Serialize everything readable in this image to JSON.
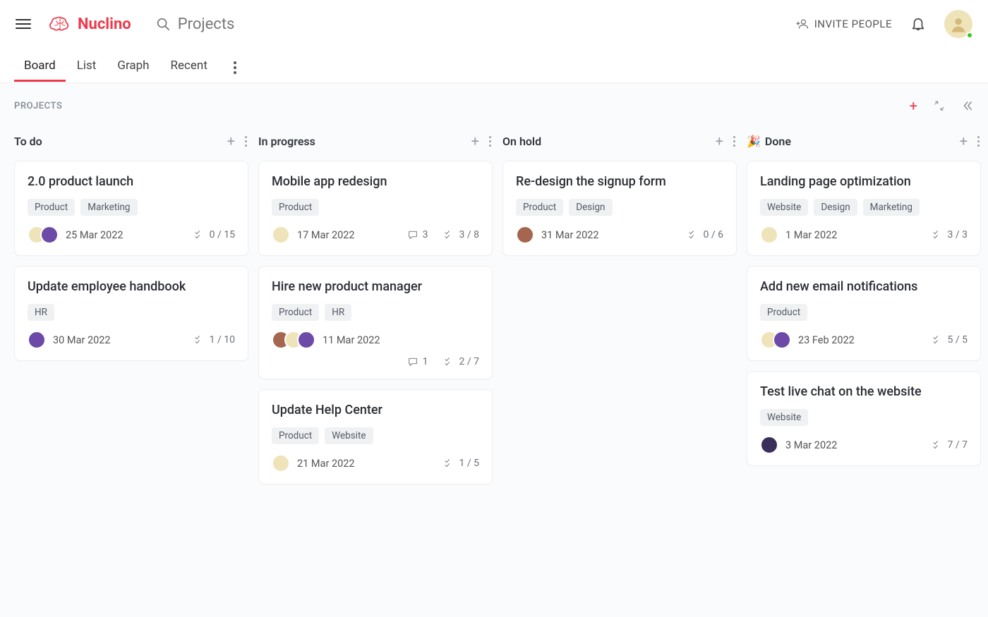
{
  "app": {
    "name": "Nuclino"
  },
  "header": {
    "search_placeholder": "Projects",
    "invite_label": "INVITE PEOPLE"
  },
  "tabs": [
    "Board",
    "List",
    "Graph",
    "Recent"
  ],
  "active_tab_index": 0,
  "board": {
    "breadcrumb": "PROJECTS",
    "columns": [
      {
        "title": "To do",
        "emoji": "",
        "cards": [
          {
            "title": "2.0 product launch",
            "tags": [
              "Product",
              "Marketing"
            ],
            "avatars": [
              "c1",
              "c2"
            ],
            "date": "25 Mar 2022",
            "comments": null,
            "checklist": "0 / 15"
          },
          {
            "title": "Update employee handbook",
            "tags": [
              "HR"
            ],
            "avatars": [
              "c2"
            ],
            "date": "30 Mar 2022",
            "comments": null,
            "checklist": "1 / 10"
          }
        ]
      },
      {
        "title": "In progress",
        "emoji": "",
        "cards": [
          {
            "title": "Mobile app redesign",
            "tags": [
              "Product"
            ],
            "avatars": [
              "c1"
            ],
            "date": "17 Mar 2022",
            "comments": "3",
            "checklist": "3 / 8"
          },
          {
            "title": "Hire new product manager",
            "tags": [
              "Product",
              "HR"
            ],
            "avatars": [
              "c3",
              "c1",
              "c2"
            ],
            "date": "11 Mar 2022",
            "comments": "1",
            "checklist": "2 / 7",
            "second_row": true
          },
          {
            "title": "Update Help Center",
            "tags": [
              "Product",
              "Website"
            ],
            "avatars": [
              "c1"
            ],
            "date": "21 Mar 2022",
            "comments": null,
            "checklist": "1 / 5"
          }
        ]
      },
      {
        "title": "On hold",
        "emoji": "",
        "cards": [
          {
            "title": "Re-design the signup form",
            "tags": [
              "Product",
              "Design"
            ],
            "avatars": [
              "c3"
            ],
            "date": "31 Mar 2022",
            "comments": null,
            "checklist": "0 / 6"
          }
        ]
      },
      {
        "title": "Done",
        "emoji": "🎉",
        "cards": [
          {
            "title": "Landing page optimization",
            "tags": [
              "Website",
              "Design",
              "Marketing"
            ],
            "avatars": [
              "c1"
            ],
            "date": "1 Mar 2022",
            "comments": null,
            "checklist": "3 / 3"
          },
          {
            "title": "Add new email notifications",
            "tags": [
              "Product"
            ],
            "avatars": [
              "c1",
              "c2"
            ],
            "date": "23 Feb 2022",
            "comments": null,
            "checklist": "5 / 5"
          },
          {
            "title": "Test live chat on the website",
            "tags": [
              "Website"
            ],
            "avatars": [
              "c4"
            ],
            "date": "3 Mar 2022",
            "comments": null,
            "checklist": "7 / 7"
          }
        ]
      }
    ]
  }
}
